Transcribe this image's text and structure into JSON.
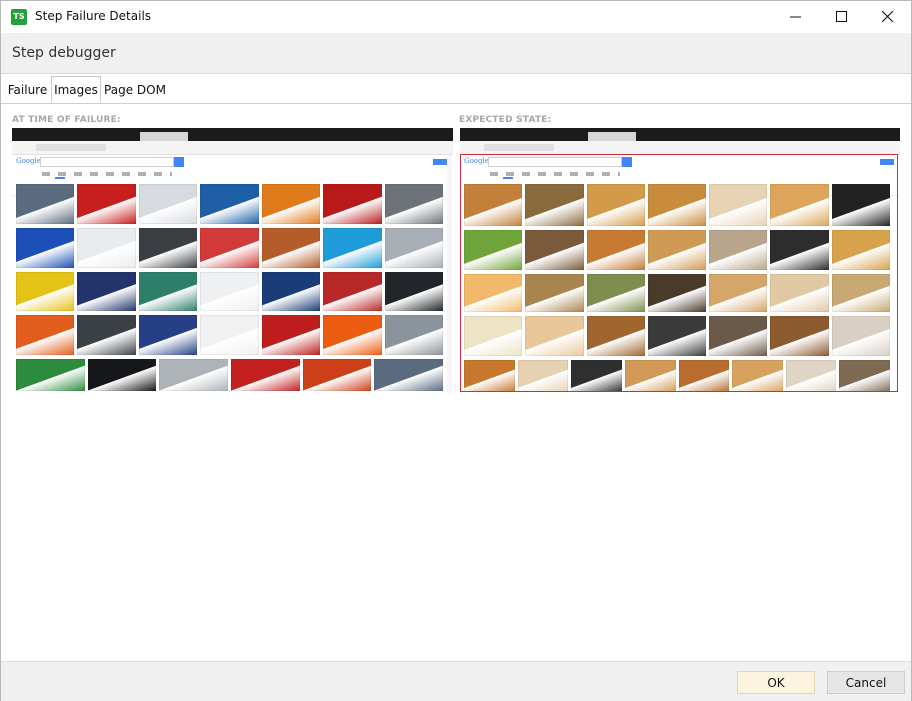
{
  "window": {
    "title": "Step Failure Details",
    "app_icon_text": "TS",
    "subheader": "Step debugger"
  },
  "tabs": [
    {
      "label": "Failure",
      "active": false
    },
    {
      "label": "Images",
      "active": true
    },
    {
      "label": "Page DOM",
      "active": false
    }
  ],
  "panels": {
    "left_label": "AT TIME OF FAILURE:",
    "right_label": "EXPECTED STATE:",
    "left_search_logo": "Google",
    "right_search_logo": "Google"
  },
  "colors": {
    "left_tiles": [
      "#5a6b80",
      "#c81e1e",
      "#d7dadf",
      "#1f5fa8",
      "#e07b1b",
      "#b81a1a",
      "#6d7378",
      "#1c4fb8",
      "#e9ecef",
      "#3b3f44",
      "#d23a3a",
      "#b55d2a",
      "#1e9bd8",
      "#a7aeb6",
      "#e5c216",
      "#23336b",
      "#2d7f6a",
      "#eef0f2",
      "#1a3c78",
      "#b82828",
      "#22262b",
      "#e25d1b",
      "#3c4147",
      "#273f86",
      "#f1f1f1",
      "#bd1d1d",
      "#ec5d12",
      "#8b949c",
      "#2c8b3c",
      "#15171a",
      "#aeb3b8",
      "#c32020",
      "#cc3f19"
    ],
    "right_tiles": [
      "#c2803a",
      "#8a6b3d",
      "#d39b49",
      "#c98c3c",
      "#e8d2b4",
      "#dca55b",
      "#222",
      "#6fa43a",
      "#7a5a3a",
      "#c77a32",
      "#cf9b54",
      "#b9a58b",
      "#2d2d2d",
      "#d7a24c",
      "#f2b96a",
      "#a8844f",
      "#7d8e4f",
      "#4a3a2a",
      "#d4a66a",
      "#e2c7a3",
      "#c8a873",
      "#efe3c6",
      "#e9c79b",
      "#a06630",
      "#3a3a3a",
      "#6b5a4a",
      "#8c5a2f",
      "#d9cfc3",
      "#c7782e",
      "#e6d2b3",
      "#2f2f2f",
      "#d39a57",
      "#b86d2f",
      "#d7a15f",
      "#e0d4c4",
      "#7e6a52",
      "#a05a2c",
      "#a8a9ab",
      "#c2a37a",
      "#4d7d44"
    ],
    "accent_ok": "#fdf4df",
    "expected_border": "#d7263d"
  },
  "footer": {
    "ok_label": "OK",
    "cancel_label": "Cancel"
  }
}
